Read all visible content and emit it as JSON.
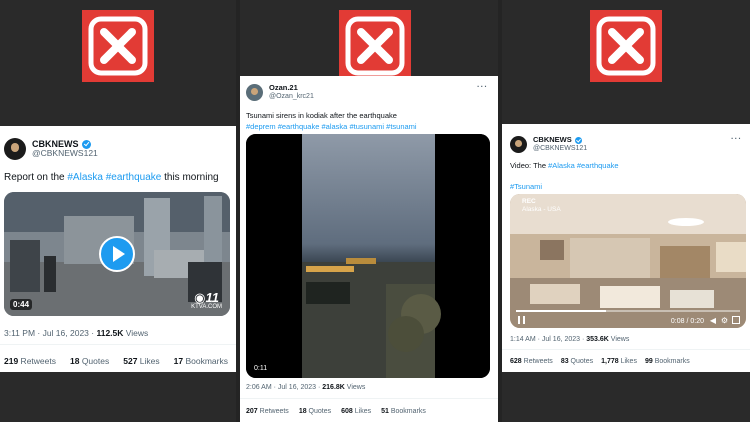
{
  "colors": {
    "x_badge": "#e23b35",
    "link": "#1d9bf0",
    "verified": "#1d9bf0"
  },
  "tweets": [
    {
      "display_name": "CBKNEWS",
      "handle": "@CBKNEWS121",
      "verified": true,
      "text_plain": "Report on the ",
      "tags": [
        "#Alaska",
        "#earthquake"
      ],
      "text_tail": " this morning",
      "video_duration": "0:44",
      "watermark": "KTVA.COM",
      "time": "3:11 PM · Jul 16, 2023 · ",
      "views_count": "112.5K",
      "views_label": " Views",
      "stats": [
        {
          "count": "219",
          "label": " Retweets"
        },
        {
          "count": "18",
          "label": " Quotes"
        },
        {
          "count": "527",
          "label": " Likes"
        },
        {
          "count": "17",
          "label": " Bookmarks"
        }
      ]
    },
    {
      "display_name": "Ozan.21",
      "handle": "@Ozan_krc21",
      "verified": false,
      "more": "···",
      "text_line1": "Tsunami sirens in kodiak after the earthquake",
      "tags": [
        "#deprem",
        "#earthquake",
        "#alaska",
        "#tusunami",
        "#tsunami"
      ],
      "video_duration": "0:11",
      "time": "2:06 AM · Jul 16, 2023 · ",
      "views_count": "216.8K",
      "views_label": " Views",
      "stats": [
        {
          "count": "207",
          "label": " Retweets"
        },
        {
          "count": "18",
          "label": " Quotes"
        },
        {
          "count": "608",
          "label": " Likes"
        },
        {
          "count": "51",
          "label": " Bookmarks"
        }
      ]
    },
    {
      "display_name": "CBKNEWS",
      "handle": "@CBKNEWS121",
      "verified": true,
      "more": "···",
      "text_plain": "Video: The ",
      "tags": [
        "#Alaska",
        "#earthquake"
      ],
      "tag_line2": "#Tsunami",
      "rec_label": "REC",
      "location_label": "Alaska - USA",
      "video_time": "0:08 / 0:20",
      "time": "1:14 AM · Jul 16, 2023 · ",
      "views_count": "353.6K",
      "views_label": " Views",
      "stats": [
        {
          "count": "628",
          "label": " Retweets"
        },
        {
          "count": "83",
          "label": " Quotes"
        },
        {
          "count": "1,778",
          "label": " Likes"
        },
        {
          "count": "99",
          "label": " Bookmarks"
        }
      ]
    }
  ],
  "video_progress": 0.4
}
